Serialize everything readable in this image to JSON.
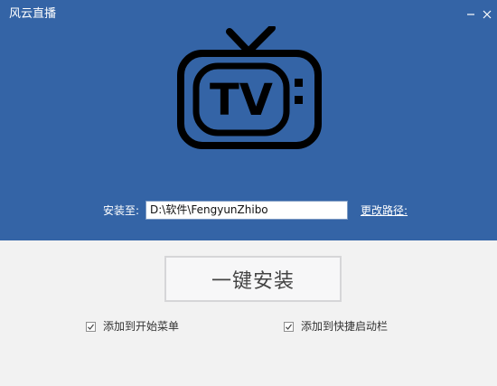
{
  "window": {
    "title": "风云直播"
  },
  "titlebar": {
    "minimize_icon": "minimize-icon",
    "close_icon": "close-icon"
  },
  "logo": {
    "icon": "tv-icon",
    "text": "TV"
  },
  "install_path": {
    "label": "安装至:",
    "value": "D:\\软件\\FengyunZhibo",
    "change_link": "更改路径:"
  },
  "install_button": {
    "label": "一键安装"
  },
  "options": [
    {
      "label": "添加到开始菜单",
      "checked": true
    },
    {
      "label": "添加到快捷启动栏",
      "checked": true
    }
  ],
  "colors": {
    "header_bg": "#3464a6",
    "body_bg": "#f2f2f2"
  }
}
